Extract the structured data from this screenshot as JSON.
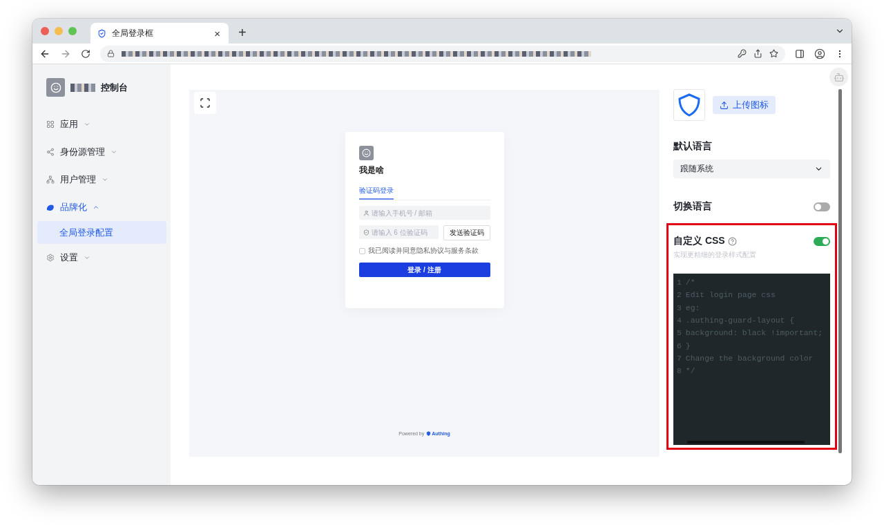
{
  "browser": {
    "tab_title": "全局登录框",
    "tab_close": "×",
    "new_tab": "+"
  },
  "sidebar": {
    "brand_suffix": "控制台",
    "items": [
      {
        "kind": "grid",
        "label": "应用",
        "expanded": false,
        "selected": false
      },
      {
        "kind": "share",
        "label": "身份源管理",
        "expanded": false,
        "selected": false
      },
      {
        "kind": "users",
        "label": "用户管理",
        "expanded": false,
        "selected": false
      },
      {
        "kind": "brand",
        "label": "品牌化",
        "expanded": true,
        "selected": true,
        "children": [
          {
            "label": "全局登录配置",
            "selected": true
          }
        ]
      },
      {
        "kind": "settings",
        "label": "设置",
        "expanded": false,
        "selected": false
      }
    ]
  },
  "preview": {
    "login": {
      "app_name": "我是啥",
      "tab": "验证码登录",
      "phone_placeholder": "请输入手机号 / 邮箱",
      "code_placeholder": "请输入 6 位验证码",
      "send_code": "发送验证码",
      "agreement": "我已阅读并同意隐私协议与服务条款",
      "agree_checked": false,
      "submit": "登录 / 注册"
    },
    "powered_by": "Powered by",
    "brand": "Authing"
  },
  "settings": {
    "upload_button": "上传图标",
    "language": {
      "label": "默认语言",
      "value": "跟随系统"
    },
    "switch_language": {
      "label": "切换语言",
      "on": false
    },
    "custom_css": {
      "label": "自定义 CSS",
      "hint": "实现更精细的登录样式配置",
      "on": true,
      "highlighted": true,
      "code": [
        {
          "number": "1",
          "text": "/*"
        },
        {
          "number": "2",
          "text": "Edit login page css"
        },
        {
          "number": "3",
          "text": "eg:"
        },
        {
          "number": "4",
          "text": ".authing-guard-layout {"
        },
        {
          "number": "5",
          "text": "background: black !important;"
        },
        {
          "number": "6",
          "text": "}"
        },
        {
          "number": "7",
          "text": "Change the background color"
        },
        {
          "number": "8",
          "text": "*/"
        }
      ]
    }
  }
}
